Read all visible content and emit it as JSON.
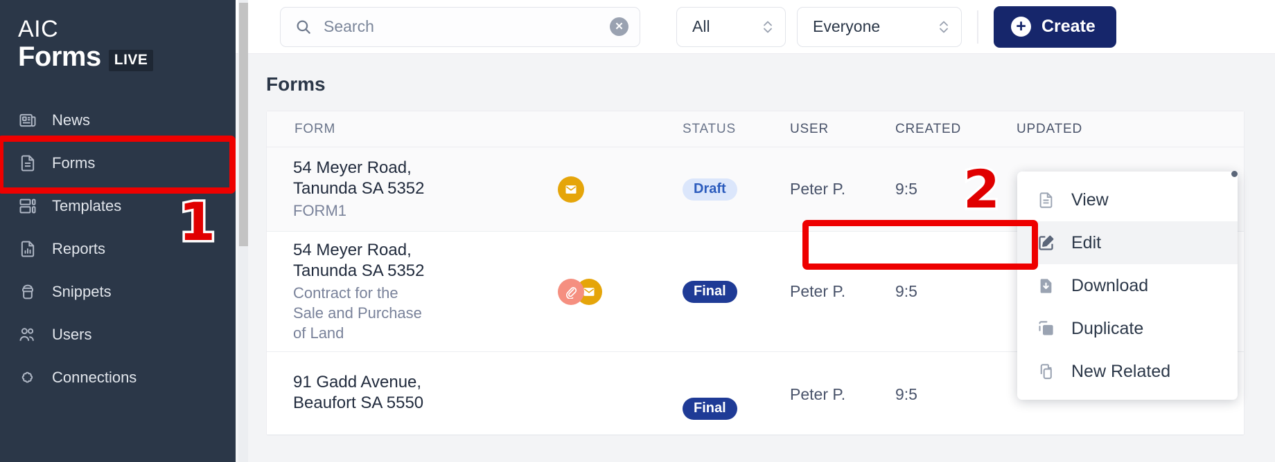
{
  "sidebar": {
    "brand": {
      "line1": "AIC",
      "line2": "Forms",
      "badge": "LIVE"
    },
    "items": [
      {
        "label": "News",
        "icon": "news-icon"
      },
      {
        "label": "Forms",
        "icon": "document-icon"
      },
      {
        "label": "Templates",
        "icon": "templates-icon"
      },
      {
        "label": "Reports",
        "icon": "report-chart-icon"
      },
      {
        "label": "Snippets",
        "icon": "snippet-icon"
      },
      {
        "label": "Users",
        "icon": "users-icon"
      },
      {
        "label": "Connections",
        "icon": "puzzle-icon"
      }
    ]
  },
  "topbar": {
    "search": {
      "value": "",
      "placeholder": "Search"
    },
    "filter_type": {
      "value": "All"
    },
    "filter_owner": {
      "value": "Everyone"
    },
    "create_label": "Create"
  },
  "page": {
    "title": "Forms"
  },
  "table": {
    "columns": [
      "FORM",
      "STATUS",
      "USER",
      "CREATED",
      "UPDATED"
    ],
    "rows": [
      {
        "name": "54 Meyer Road,\nTanunda SA 5352",
        "sub": "FORM1",
        "icons": [
          "mail-icon"
        ],
        "status": "Draft",
        "status_kind": "draft",
        "user": "Peter P.",
        "created": "9:5",
        "updated": ""
      },
      {
        "name": "54 Meyer Road,\nTanunda SA 5352",
        "sub": "Contract for the\nSale and Purchase\nof Land",
        "icons": [
          "paperclip-icon",
          "mail-icon"
        ],
        "status": "Final",
        "status_kind": "final",
        "user": "Peter P.",
        "created": "9:5",
        "updated": ""
      },
      {
        "name": "91 Gadd Avenue,\nBeaufort SA 5550",
        "sub": "",
        "icons": [],
        "status": "Final",
        "status_kind": "final",
        "user": "Peter P.",
        "created": "9:5",
        "updated": ""
      }
    ]
  },
  "context_menu": {
    "items": [
      {
        "label": "View",
        "icon": "document-icon",
        "highlighted": false
      },
      {
        "label": "Edit",
        "icon": "pencil-square-icon",
        "highlighted": true
      },
      {
        "label": "Download",
        "icon": "download-icon",
        "highlighted": false
      },
      {
        "label": "Duplicate",
        "icon": "duplicate-icon",
        "highlighted": false
      },
      {
        "label": "New Related",
        "icon": "copy-pages-icon",
        "highlighted": false
      }
    ]
  },
  "annotations": {
    "step1": "1",
    "step2": "2"
  },
  "colors": {
    "sidebar_bg": "#2b3748",
    "accent_blue": "#16266b",
    "annotation_red": "#ee0000",
    "mail_amber": "#e5a50a",
    "clip_salmon": "#f58f80",
    "final_badge": "#1f3b96",
    "draft_badge_bg": "#dbe6fb"
  }
}
